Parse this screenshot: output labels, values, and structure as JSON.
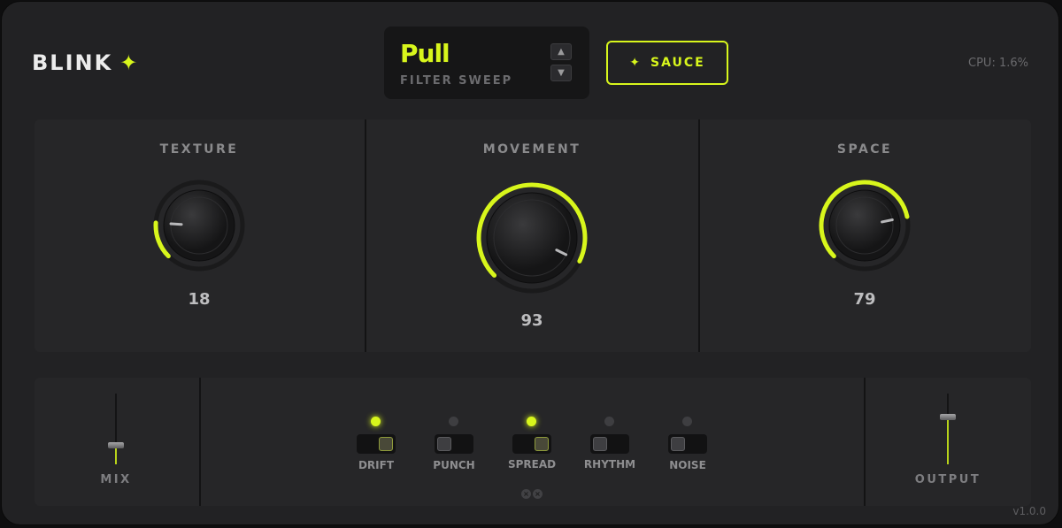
{
  "brand": {
    "name": "BLINK",
    "icon": "sparkle-icon",
    "accent": "#d8f61c"
  },
  "preset": {
    "name": "Pull",
    "category": "FILTER SWEEP",
    "up": "▲",
    "down": "▼"
  },
  "sauce_button": {
    "label": "SAUCE",
    "icon": "✦"
  },
  "cpu": "CPU: 1.6%",
  "knobs": [
    {
      "label": "TEXTURE",
      "value": "18"
    },
    {
      "label": "MOVEMENT",
      "value": "93"
    },
    {
      "label": "SPACE",
      "value": "79"
    }
  ],
  "faders": {
    "mix": {
      "label": "MIX",
      "level": 0.28
    },
    "output": {
      "label": "OUTPUT",
      "level": 0.68
    }
  },
  "toggles": [
    {
      "label": "DRIFT",
      "on": true
    },
    {
      "label": "PUNCH",
      "on": false
    },
    {
      "label": "SPREAD",
      "on": true
    },
    {
      "label": "RHYTHM",
      "on": false
    },
    {
      "label": "NOISE",
      "on": false
    }
  ],
  "version": "v1.0.0"
}
